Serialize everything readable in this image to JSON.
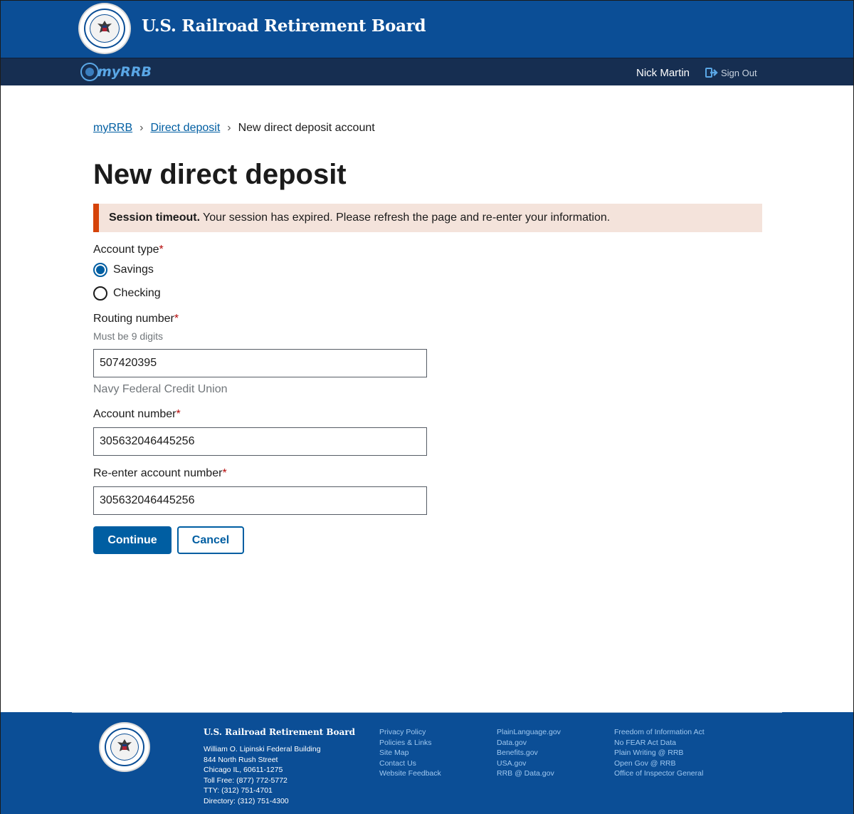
{
  "header": {
    "agency_title": "U.S. Railroad Retirement Board",
    "app_name": "myRRB",
    "user_name": "Nick Martin",
    "sign_out_label": "Sign Out"
  },
  "breadcrumb": {
    "items": [
      "myRRB",
      "Direct deposit"
    ],
    "current": "New direct deposit account"
  },
  "page_title": "New direct deposit",
  "alert": {
    "heading": "Session timeout.",
    "message": "Your session has expired. Please refresh the page and re-enter your information."
  },
  "form": {
    "account_type": {
      "label": "Account type",
      "required_mark": "*",
      "options": [
        {
          "label": "Savings",
          "checked": true
        },
        {
          "label": "Checking",
          "checked": false
        }
      ]
    },
    "routing_number": {
      "label": "Routing number",
      "required_mark": "*",
      "hint": "Must be 9 digits",
      "value": "507420395",
      "bank_name": "Navy Federal Credit Union"
    },
    "account_number": {
      "label": "Account number",
      "required_mark": "*",
      "value": "305632046445256"
    },
    "reenter_account_number": {
      "label": "Re-enter account number",
      "required_mark": "*",
      "value": "305632046445256"
    },
    "continue_label": "Continue",
    "cancel_label": "Cancel"
  },
  "footer": {
    "agency_title": "U.S. Railroad Retirement Board",
    "address_lines": [
      "William O. Lipinski Federal Building",
      "844 North Rush Street",
      "Chicago IL, 60611-1275",
      "Toll Free: (877) 772-5772",
      "TTY: (312) 751-4701",
      "Directory: (312) 751-4300"
    ],
    "links_col1": [
      "Privacy Policy",
      "Policies & Links",
      "Site Map",
      "Contact Us",
      "Website Feedback"
    ],
    "links_col2": [
      "PlainLanguage.gov",
      "Data.gov",
      "Benefits.gov",
      "USA.gov",
      "RRB @ Data.gov"
    ],
    "links_col3": [
      "Freedom of Information Act",
      "No FEAR Act Data",
      "Plain Writing @ RRB",
      "Open Gov @ RRB",
      "Office of Inspector General"
    ]
  },
  "colors": {
    "header_blue": "#0b4e96",
    "subheader_navy": "#162e51",
    "primary_button": "#005ea2",
    "alert_background": "#f4e3db",
    "alert_border": "#d54309",
    "required_red": "#b50909"
  },
  "icons": {
    "seal": "rrb-seal-icon",
    "sign_out": "sign-out-icon",
    "breadcrumb_separator": "chevron-right-icon"
  }
}
